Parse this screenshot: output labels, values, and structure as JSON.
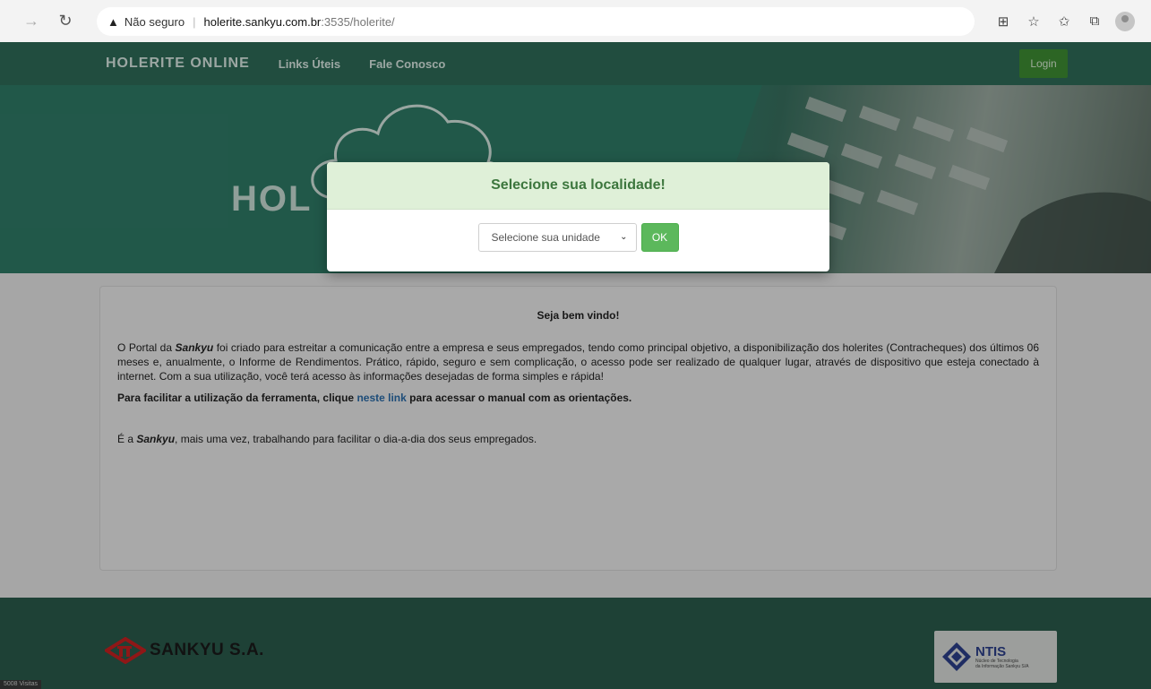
{
  "browser": {
    "security_label": "Não seguro",
    "url_host": "holerite.sankyu.com.br",
    "url_rest": ":3535/holerite/"
  },
  "nav": {
    "brand": "HOLERITE ONLINE",
    "links": [
      "Links Úteis",
      "Fale Conosco"
    ],
    "login_label": "Login"
  },
  "hero": {
    "logo_text": "HOL"
  },
  "modal": {
    "title": "Selecione sua localidade!",
    "select_value": "Selecione sua unidade",
    "ok_label": "OK"
  },
  "content": {
    "welcome": "Seja bem vindo!",
    "p1_pre": "O Portal da ",
    "p1_brand": "Sankyu",
    "p1_post": " foi criado para estreitar a comunicação entre a empresa e seus empregados, tendo como principal objetivo, a disponibilização dos holerites (Contracheques) dos últimos 06 meses e, anualmente, o Informe de Rendimentos. Prático, rápido, seguro e sem complicação, o acesso pode ser realizado de qualquer lugar, através de dispositivo que esteja conectado à internet. Com a sua utilização, você terá acesso às informações desejadas de forma simples e rápida!",
    "p2_pre": "Para facilitar a utilização da ferramenta, clique ",
    "p2_link": "neste link",
    "p2_post": " para acessar o manual com as orientações.",
    "p3_pre": "É a ",
    "p3_brand": "Sankyu",
    "p3_post": ", mais uma vez, trabalhando para facilitar o dia-a-dia dos seus empregados."
  },
  "footer": {
    "company": "SANKYU S.A.",
    "ntis_title": "NTIS",
    "ntis_sub1": "Núcleo de Tecnologia",
    "ntis_sub2": "da Informação Sankyu S/A",
    "visits": "5008 Visitas"
  },
  "colors": {
    "nav_bg": "#2e6b58",
    "hero_bg": "#2f7a66",
    "modal_header_bg": "#dff0d8",
    "modal_title": "#3c763d",
    "ok_button": "#5cb85c",
    "login_button": "#3d8c33",
    "footer_bg": "#2a5a4b"
  }
}
